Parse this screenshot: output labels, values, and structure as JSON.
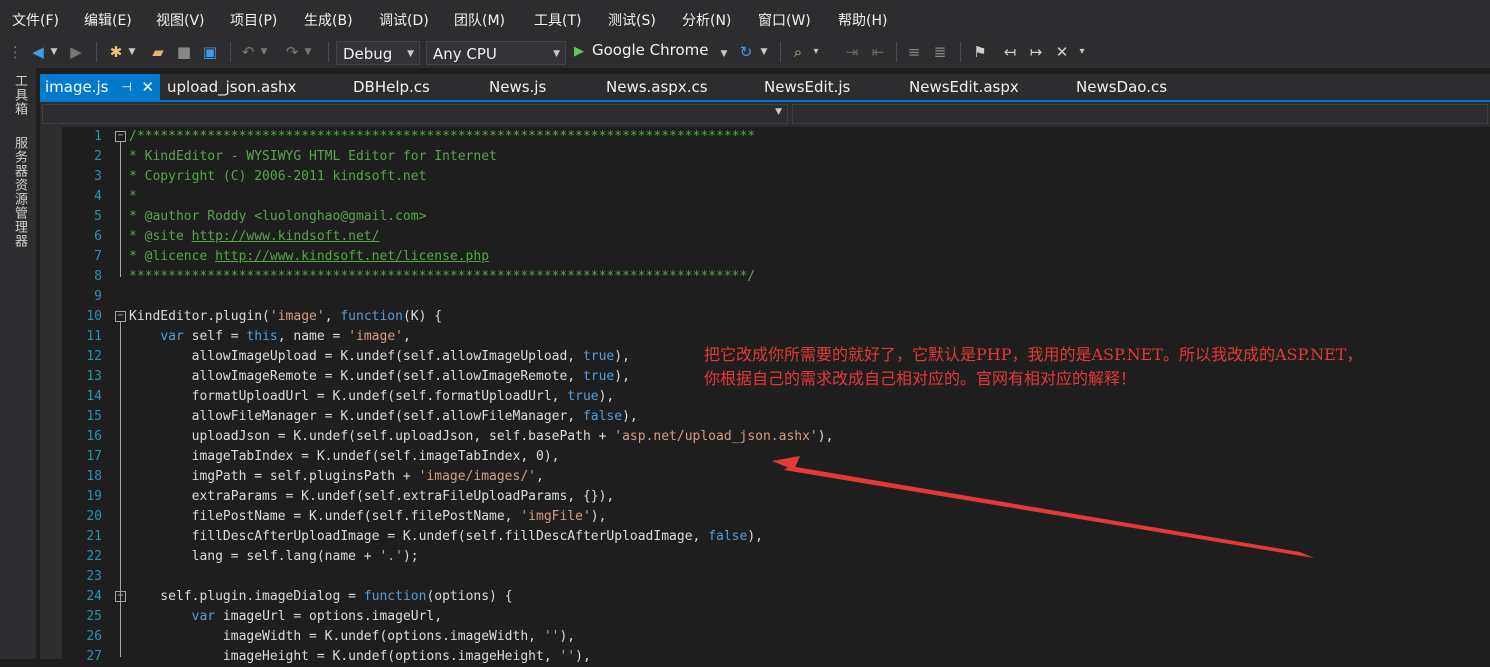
{
  "menu": [
    "文件(F)",
    "编辑(E)",
    "视图(V)",
    "项目(P)",
    "生成(B)",
    "调试(D)",
    "团队(M)",
    "工具(T)",
    "测试(S)",
    "分析(N)",
    "窗口(W)",
    "帮助(H)"
  ],
  "toolbar": {
    "config": "Debug",
    "platform": "Any CPU",
    "run_target": "Google Chrome"
  },
  "side_panels": [
    "工具箱",
    "服务器资源管理器"
  ],
  "tabs": [
    {
      "label": "image.js",
      "active": true
    },
    {
      "label": "upload_json.ashx"
    },
    {
      "label": "DBHelp.cs"
    },
    {
      "label": "News.js"
    },
    {
      "label": "News.aspx.cs"
    },
    {
      "label": "NewsEdit.js"
    },
    {
      "label": "NewsEdit.aspx"
    },
    {
      "label": "NewsDao.cs"
    }
  ],
  "code": [
    {
      "n": "1",
      "fold": true,
      "t": [
        [
          "c",
          "/*******************************************************************************"
        ]
      ]
    },
    {
      "n": "2",
      "t": [
        [
          "c",
          "* KindEditor - WYSIWYG HTML Editor for Internet"
        ]
      ]
    },
    {
      "n": "3",
      "t": [
        [
          "c",
          "* Copyright (C) 2006-2011 kindsoft.net"
        ]
      ]
    },
    {
      "n": "4",
      "t": [
        [
          "c",
          "*"
        ]
      ]
    },
    {
      "n": "5",
      "t": [
        [
          "c",
          "* @author Roddy <luolonghao@gmail.com>"
        ]
      ]
    },
    {
      "n": "6",
      "t": [
        [
          "c",
          "* @site "
        ],
        [
          "u",
          "http://www.kindsoft.net/"
        ]
      ]
    },
    {
      "n": "7",
      "t": [
        [
          "c",
          "* @licence "
        ],
        [
          "u",
          "http://www.kindsoft.net/license.php"
        ]
      ]
    },
    {
      "n": "8",
      "t": [
        [
          "c",
          "*******************************************************************************/"
        ]
      ]
    },
    {
      "n": "9",
      "t": []
    },
    {
      "n": "10",
      "fold": true,
      "t": [
        [
          "p",
          "KindEditor.plugin("
        ],
        [
          "s",
          "'image'"
        ],
        [
          "p",
          ", "
        ],
        [
          "k",
          "function"
        ],
        [
          "p",
          "(K) {"
        ]
      ]
    },
    {
      "n": "11",
      "t": [
        [
          "p",
          "    "
        ],
        [
          "k",
          "var"
        ],
        [
          "p",
          " self = "
        ],
        [
          "k",
          "this"
        ],
        [
          "p",
          ", name = "
        ],
        [
          "s",
          "'image'"
        ],
        [
          "p",
          ","
        ]
      ]
    },
    {
      "n": "12",
      "t": [
        [
          "p",
          "        allowImageUpload = K.undef(self.allowImageUpload, "
        ],
        [
          "k",
          "true"
        ],
        [
          "p",
          "),"
        ]
      ]
    },
    {
      "n": "13",
      "t": [
        [
          "p",
          "        allowImageRemote = K.undef(self.allowImageRemote, "
        ],
        [
          "k",
          "true"
        ],
        [
          "p",
          "),"
        ]
      ]
    },
    {
      "n": "14",
      "t": [
        [
          "p",
          "        formatUploadUrl = K.undef(self.formatUploadUrl, "
        ],
        [
          "k",
          "true"
        ],
        [
          "p",
          "),"
        ]
      ]
    },
    {
      "n": "15",
      "t": [
        [
          "p",
          "        allowFileManager = K.undef(self.allowFileManager, "
        ],
        [
          "k",
          "false"
        ],
        [
          "p",
          "),"
        ]
      ]
    },
    {
      "n": "16",
      "t": [
        [
          "p",
          "        uploadJson = K.undef(self.uploadJson, self.basePath + "
        ],
        [
          "s",
          "'asp.net/upload_json.ashx'"
        ],
        [
          "p",
          "),"
        ]
      ]
    },
    {
      "n": "17",
      "t": [
        [
          "p",
          "        imageTabIndex = K.undef(self.imageTabIndex, 0),"
        ]
      ]
    },
    {
      "n": "18",
      "t": [
        [
          "p",
          "        imgPath = self.pluginsPath + "
        ],
        [
          "s",
          "'image/images/'"
        ],
        [
          "p",
          ","
        ]
      ]
    },
    {
      "n": "19",
      "t": [
        [
          "p",
          "        extraParams = K.undef(self.extraFileUploadParams, {}),"
        ]
      ]
    },
    {
      "n": "20",
      "t": [
        [
          "p",
          "        filePostName = K.undef(self.filePostName, "
        ],
        [
          "s",
          "'imgFile'"
        ],
        [
          "p",
          "),"
        ]
      ]
    },
    {
      "n": "21",
      "t": [
        [
          "p",
          "        fillDescAfterUploadImage = K.undef(self.fillDescAfterUploadImage, "
        ],
        [
          "k",
          "false"
        ],
        [
          "p",
          "),"
        ]
      ]
    },
    {
      "n": "22",
      "t": [
        [
          "p",
          "        lang = self.lang(name + "
        ],
        [
          "s",
          "'.'"
        ],
        [
          "p",
          ");"
        ]
      ]
    },
    {
      "n": "23",
      "t": []
    },
    {
      "n": "24",
      "fold": true,
      "t": [
        [
          "p",
          "    self.plugin.imageDialog = "
        ],
        [
          "k",
          "function"
        ],
        [
          "p",
          "(options) {"
        ]
      ]
    },
    {
      "n": "25",
      "t": [
        [
          "p",
          "        "
        ],
        [
          "k",
          "var"
        ],
        [
          "p",
          " imageUrl = options.imageUrl,"
        ]
      ]
    },
    {
      "n": "26",
      "t": [
        [
          "p",
          "            imageWidth = K.undef(options.imageWidth, "
        ],
        [
          "s",
          "''"
        ],
        [
          "p",
          "),"
        ]
      ]
    },
    {
      "n": "27",
      "t": [
        [
          "p",
          "            imageHeight = K.undef(options.imageHeight, "
        ],
        [
          "s",
          "''"
        ],
        [
          "p",
          "),"
        ]
      ]
    }
  ],
  "annotation": {
    "line1": "把它改成你所需要的就好了，它默认是PHP，我用的是ASP.NET。所以我改成的ASP.NET，",
    "line2": "你根据自己的需求改成自己相对应的。官网有相对应的解释！",
    "color": "#e53935"
  }
}
